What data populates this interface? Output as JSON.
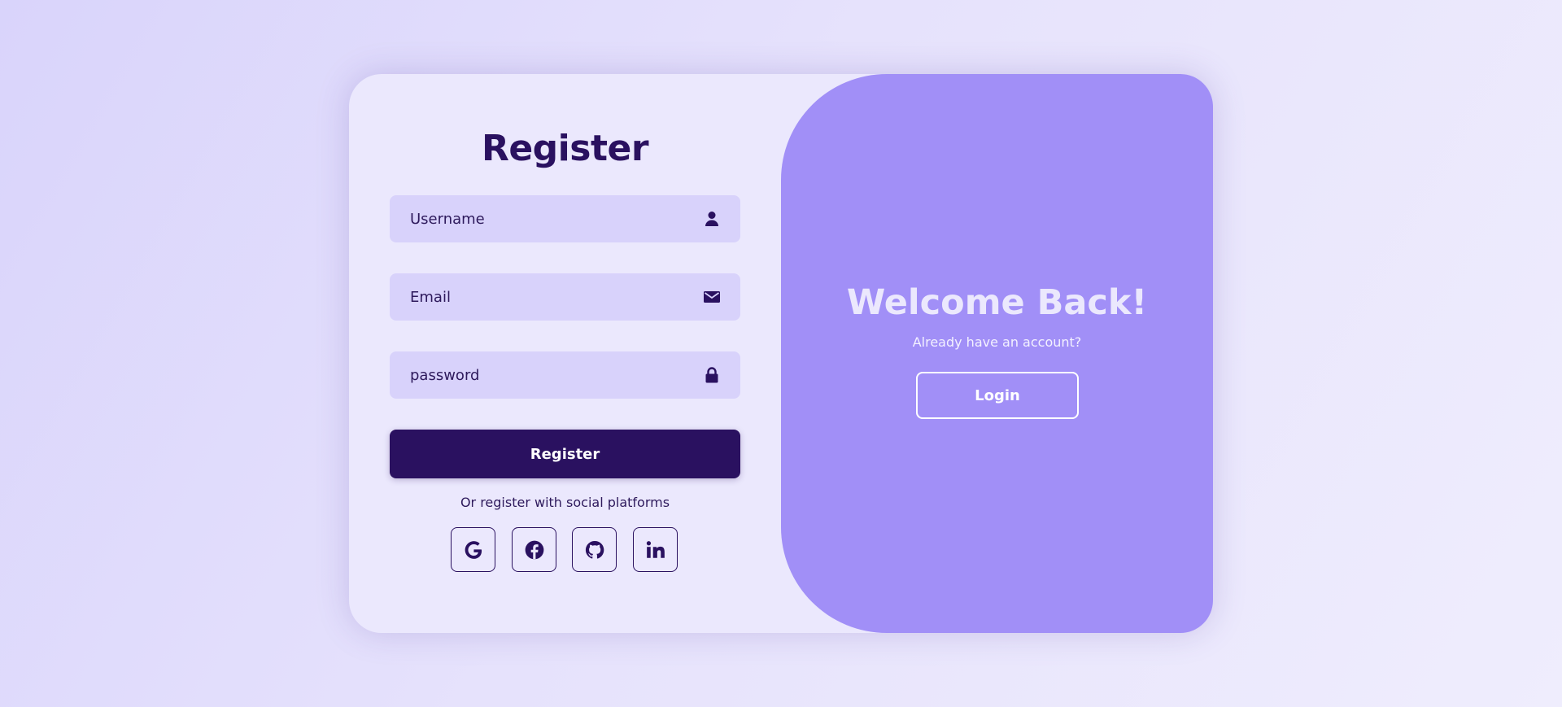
{
  "register": {
    "title": "Register",
    "fields": {
      "username": {
        "placeholder": "Username",
        "value": "",
        "icon": "user-icon"
      },
      "email": {
        "placeholder": "Email",
        "value": "",
        "icon": "envelope-icon"
      },
      "password": {
        "placeholder": "password",
        "value": "",
        "icon": "lock-icon"
      }
    },
    "submit_label": "Register",
    "social_text": "Or register with social platforms",
    "social_icons": [
      "google-icon",
      "facebook-icon",
      "github-icon",
      "linkedin-icon"
    ]
  },
  "panel": {
    "welcome_title": "Welcome Back!",
    "subtitle": "Already have an account?",
    "login_label": "Login"
  },
  "colors": {
    "primary": "#2a1160",
    "panel": "#a18ff7",
    "card": "#ebe8fd",
    "field": "#d8d2fb"
  }
}
